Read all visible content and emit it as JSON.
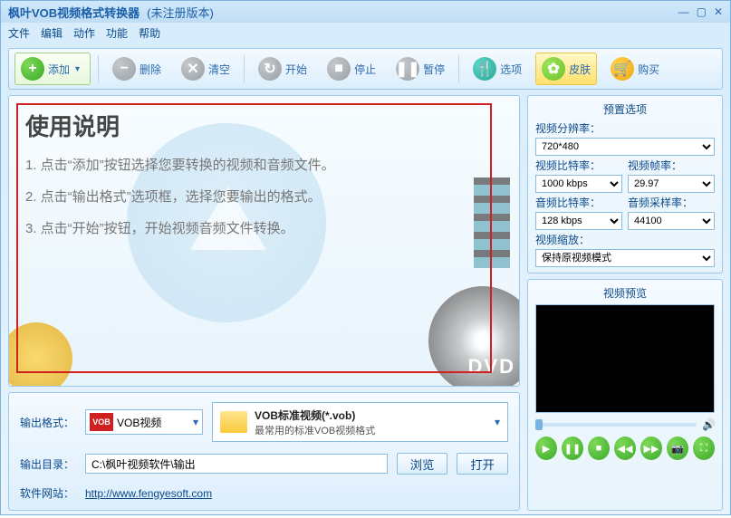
{
  "title": "枫叶VOB视频格式转换器",
  "subtitle": "(未注册版本)",
  "menu": {
    "file": "文件",
    "edit": "编辑",
    "action": "动作",
    "func": "功能",
    "help": "帮助"
  },
  "toolbar": {
    "add": "添加",
    "delete": "删除",
    "clear": "清空",
    "start": "开始",
    "stop": "停止",
    "pause": "暂停",
    "options": "选项",
    "skin": "皮肤",
    "buy": "购买"
  },
  "instructions": {
    "heading": "使用说明",
    "line1": "1. 点击“添加”按钮选择您要转换的视频和音频文件。",
    "line2": "2. 点击“输出格式”选项框，选择您要输出的格式。",
    "line3": "3. 点击“开始”按钮，开始视频音频文件转换。",
    "dvd": "DVD"
  },
  "output": {
    "format_label": "输出格式：",
    "format_value": "VOB视频",
    "vob_badge": "VOB",
    "format_title": "VOB标准视频(*.vob)",
    "format_desc": "最常用的标准VOB视频格式",
    "dir_label": "输出目录：",
    "dir_value": "C:\\枫叶视频软件\\输出",
    "browse": "浏览",
    "open": "打开",
    "site_label": "软件网站：",
    "site_url": "http://www.fengyesoft.com"
  },
  "preset": {
    "title": "预置选项",
    "resolution_label": "视频分辨率：",
    "resolution": "720*480",
    "vbitrate_label": "视频比特率：",
    "vbitrate": "1000 kbps",
    "fps_label": "视频帧率：",
    "fps": "29.97",
    "abitrate_label": "音频比特率：",
    "abitrate": "128 kbps",
    "asample_label": "音频采样率：",
    "asample": "44100",
    "scale_label": "视频缩放：",
    "scale": "保持原视频模式"
  },
  "preview": {
    "title": "视频预览"
  }
}
